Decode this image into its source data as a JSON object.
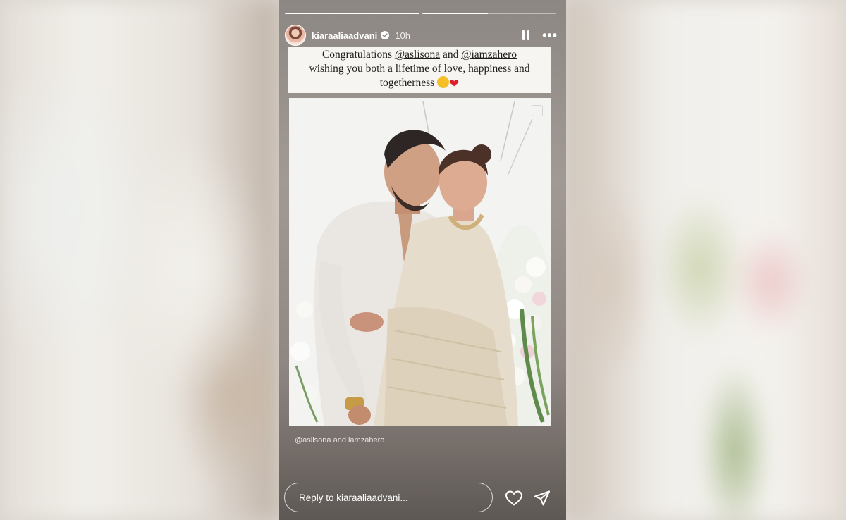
{
  "story": {
    "username": "kiaraaliaadvani",
    "verified": true,
    "time_ago": "10h",
    "progress": {
      "segments": 2,
      "current": 2,
      "fraction_of_current": 0.49
    }
  },
  "caption": {
    "line1_prefix": "Congratulations ",
    "mention1": "@aslisona",
    "line1_mid": " and ",
    "mention2": "@iamzahero",
    "line2": "wishing you both a lifetime of love, happiness and",
    "line3": "togetherness"
  },
  "photo_tags": "@aslisona and iamzahero",
  "reply": {
    "placeholder": "Reply to kiaraaliaadvani..."
  },
  "icons": {
    "pause": "pause-icon",
    "more": "more-icon",
    "like": "heart-icon",
    "send": "send-icon"
  },
  "colors": {
    "verified_badge": "#ffffff",
    "heart_emoji": "#e01d2a"
  }
}
